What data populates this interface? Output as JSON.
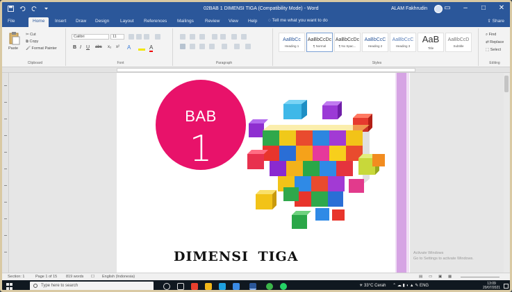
{
  "titlebar": {
    "doc_title": "02BAB 1 DIMENSI TIGA (Compatibility Mode)  -  Word",
    "user_name": "ALAM Fakhrudin",
    "colors": {
      "bar": "#2b579a"
    }
  },
  "tabs": [
    "File",
    "Home",
    "Insert",
    "Draw",
    "Design",
    "Layout",
    "References",
    "Mailings",
    "Review",
    "View",
    "Help"
  ],
  "active_tab": "Home",
  "tell_me": "Tell me what you want to do",
  "share": "Share",
  "ribbon": {
    "clipboard": {
      "paste": "Paste",
      "cut": "Cut",
      "copy": "Copy",
      "format_painter": "Format Painter",
      "label": "Clipboard"
    },
    "font": {
      "name": "Calibri",
      "size": "11",
      "label": "Font"
    },
    "paragraph": {
      "label": "Paragraph"
    },
    "styles": {
      "label": "Styles",
      "items": [
        {
          "sample": "AaBbCc",
          "name": "Heading 1"
        },
        {
          "sample": "AaBbCcDc",
          "name": "¶ Normal"
        },
        {
          "sample": "AaBbCcDc",
          "name": "¶ No Spac..."
        },
        {
          "sample": "AaBbCcC",
          "name": "Heading 2"
        },
        {
          "sample": "AaBbCcC",
          "name": "Heading 3"
        },
        {
          "sample": "AaB",
          "name": "Title"
        },
        {
          "sample": "AaBbCcD",
          "name": "Subtitle"
        }
      ]
    },
    "editing": {
      "find": "Find",
      "replace": "Replace",
      "select": "Select",
      "label": "Editing"
    }
  },
  "document": {
    "bab_word": "BAB",
    "bab_number": "1",
    "heading": "DIMENSI TIGA",
    "colors": {
      "circle": "#e8126a",
      "margin_bar": "#d6a4e4"
    },
    "image": "colorful-cubes-illustration"
  },
  "watermark": [
    "Activate Windows",
    "Go to Settings to activate Windows."
  ],
  "statusbar": {
    "section": "Section: 1",
    "page": "Page 1 of 15",
    "words": "819 words",
    "language": "English (Indonesia)"
  },
  "taskbar": {
    "search_placeholder": "Type here to search",
    "weather": "33°C  Cerah",
    "clock_time": "13:09",
    "clock_date": "20/07/2021"
  }
}
